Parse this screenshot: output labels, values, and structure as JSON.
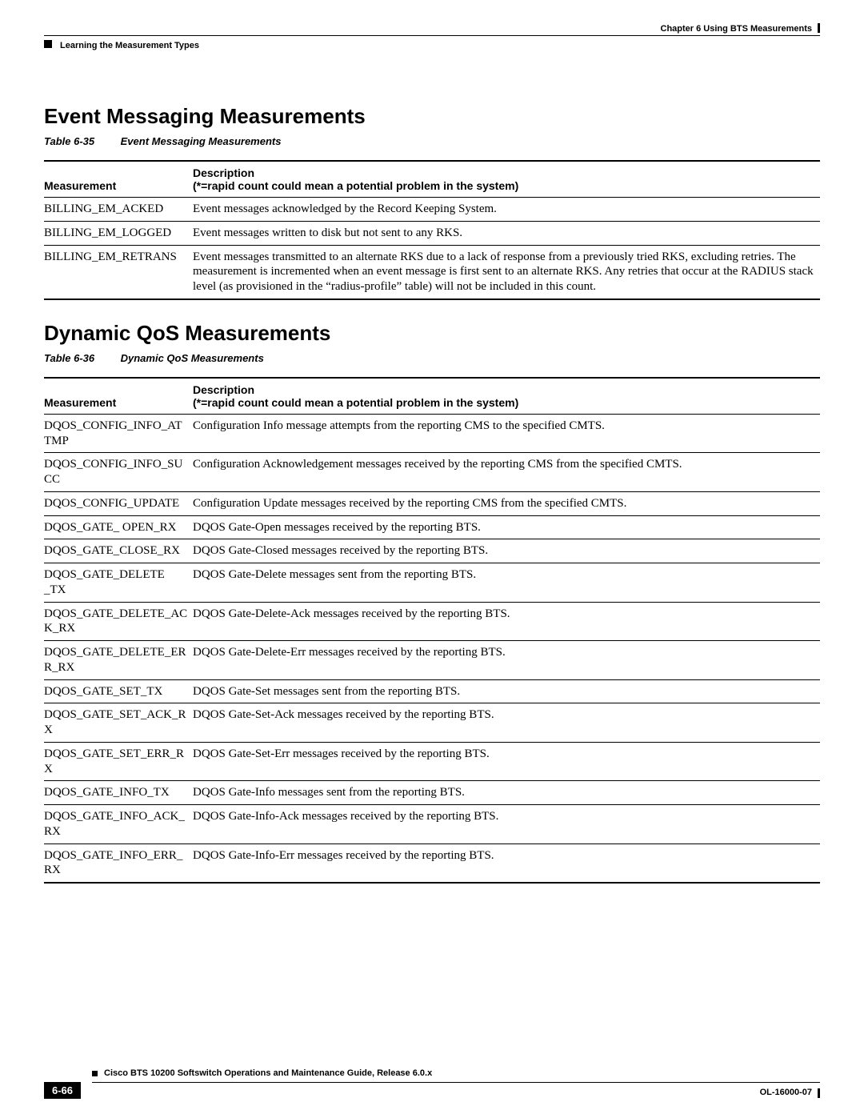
{
  "header": {
    "left_crumb": "Learning the Measurement Types",
    "chapter": "Chapter 6      Using BTS Measurements"
  },
  "section1": {
    "heading": "Event Messaging Measurements",
    "table_num": "Table 6-35",
    "table_title": "Event Messaging Measurements",
    "th_meas": "Measurement",
    "th_desc1": "Description",
    "th_desc2": "(*=rapid count could mean a potential problem in the system)",
    "rows": [
      {
        "m": "BILLING_EM_ACKED",
        "d": "Event messages acknowledged by the Record Keeping System."
      },
      {
        "m": "BILLING_EM_LOGGED",
        "d": "Event messages written to disk but not sent to any RKS."
      },
      {
        "m": "BILLING_EM_RETRANS",
        "d": "Event messages transmitted to an alternate RKS due to a lack of response from a previously tried RKS, excluding retries. The measurement is incremented when an event message is first sent to an alternate RKS. Any retries that occur at the RADIUS stack level (as provisioned in the “radius-profile” table) will not be included in this count."
      }
    ]
  },
  "section2": {
    "heading": "Dynamic QoS Measurements",
    "table_num": "Table 6-36",
    "table_title": "Dynamic QoS Measurements",
    "th_meas": "Measurement",
    "th_desc1": "Description",
    "th_desc2": "(*=rapid count could mean a potential problem in the system)",
    "rows": [
      {
        "m": "DQOS_CONFIG_INFO_ATTMP",
        "d": "Configuration Info message attempts from the reporting CMS to the specified CMTS."
      },
      {
        "m": "DQOS_CONFIG_INFO_SUCC",
        "d": "Configuration Acknowledgement messages received by the reporting CMS from the specified CMTS."
      },
      {
        "m": "DQOS_CONFIG_UPDATE",
        "d": "Configuration Update messages received by the reporting CMS from the specified CMTS."
      },
      {
        "m": "DQOS_GATE_ OPEN_RX",
        "d": "DQOS Gate-Open messages received by the reporting BTS."
      },
      {
        "m": "DQOS_GATE_CLOSE_RX",
        "d": "DQOS Gate-Closed messages received by the reporting BTS."
      },
      {
        "m": "DQOS_GATE_DELETE _TX",
        "d": "DQOS Gate-Delete messages sent from the reporting BTS."
      },
      {
        "m": "DQOS_GATE_DELETE_ACK_RX",
        "d": "DQOS Gate-Delete-Ack messages received by the reporting BTS."
      },
      {
        "m": "DQOS_GATE_DELETE_ERR_RX",
        "d": "DQOS Gate-Delete-Err messages received by the reporting BTS."
      },
      {
        "m": "DQOS_GATE_SET_TX",
        "d": "DQOS Gate-Set messages sent from the reporting BTS."
      },
      {
        "m": "DQOS_GATE_SET_ACK_RX",
        "d": "DQOS Gate-Set-Ack messages received by the reporting BTS."
      },
      {
        "m": "DQOS_GATE_SET_ERR_RX",
        "d": "DQOS Gate-Set-Err messages received by the reporting BTS."
      },
      {
        "m": "DQOS_GATE_INFO_TX",
        "d": "DQOS Gate-Info messages sent from the reporting BTS."
      },
      {
        "m": "DQOS_GATE_INFO_ACK_RX",
        "d": "DQOS Gate-Info-Ack messages received by the reporting BTS."
      },
      {
        "m": "DQOS_GATE_INFO_ERR_RX",
        "d": "DQOS Gate-Info-Err messages received by the reporting BTS."
      }
    ]
  },
  "footer": {
    "title": "Cisco BTS 10200 Softswitch Operations and Maintenance Guide, Release 6.0.x",
    "page": "6-66",
    "docnum": "OL-16000-07"
  }
}
